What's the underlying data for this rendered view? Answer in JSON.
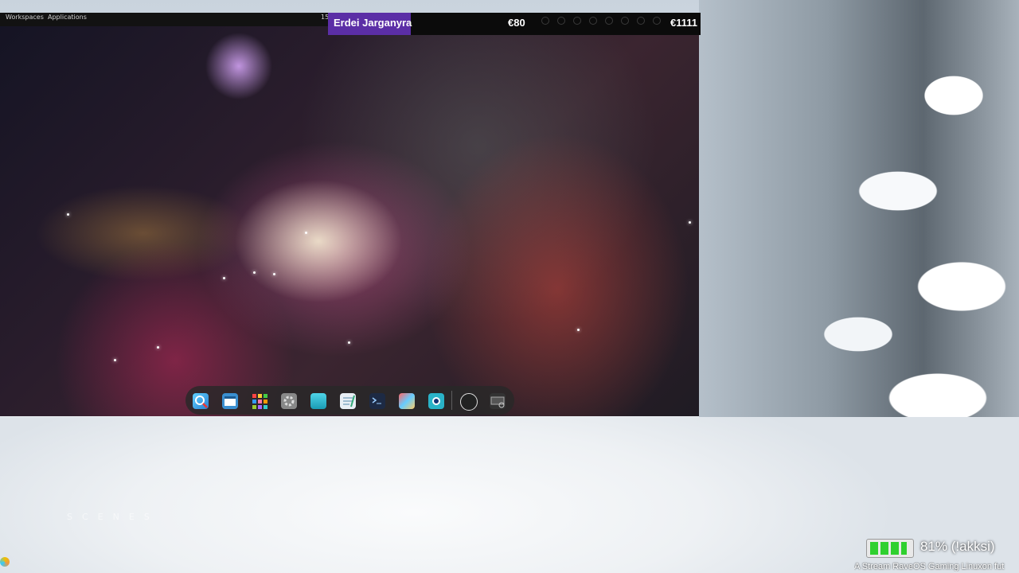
{
  "top_panel": {
    "workspaces_label": "Workspaces",
    "applications_label": "Applications",
    "workspace_number": "15"
  },
  "title_bar": {
    "name": "Erdei Jarganyra",
    "price_left": "€80",
    "price_right": "€1111"
  },
  "dock": {
    "items": [
      {
        "name": "search",
        "icon": "magnifier-icon"
      },
      {
        "name": "window-manager",
        "icon": "windows-icon"
      },
      {
        "name": "app-grid",
        "icon": "grid-icon"
      },
      {
        "name": "settings",
        "icon": "gear-icon"
      },
      {
        "name": "files",
        "icon": "folder-icon"
      },
      {
        "name": "text-editor",
        "icon": "notepad-icon"
      },
      {
        "name": "terminal",
        "icon": "terminal-icon"
      },
      {
        "name": "software-installer",
        "icon": "download-icon"
      },
      {
        "name": "screenshot",
        "icon": "camera-icon"
      },
      {
        "name": "obs-studio",
        "icon": "obs-icon"
      },
      {
        "name": "system-monitor",
        "icon": "monitor-icon"
      }
    ]
  },
  "battery": {
    "level_percent": 81,
    "text": "81% (!akksi)"
  },
  "ticker": {
    "text": "A Stream RaveOS Gaming Linuxon fut"
  },
  "watermark": {
    "text": "SCENES"
  },
  "colors": {
    "title_accent": "#5b2ea6",
    "battery_green": "#2fd02f",
    "panel_bg": "#121212"
  }
}
